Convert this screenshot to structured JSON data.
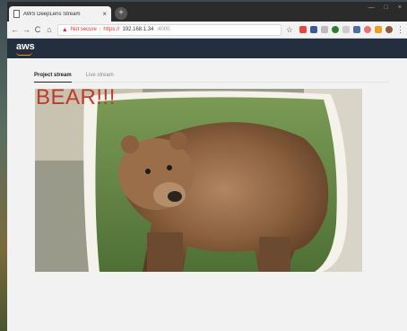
{
  "browser": {
    "tab_title": "AWS DeepLens Stream",
    "tab_close": "×",
    "new_tab": "+",
    "window_controls": [
      "—",
      "□",
      "×"
    ],
    "nav": {
      "back": "←",
      "forward": "→",
      "reload": "C",
      "home": "⌂"
    },
    "security_label": "Not secure",
    "url_scheme": "https://",
    "url_host": "192.168.1.34",
    "url_port": ":4000",
    "bookmark_icon": "star-icon"
  },
  "app": {
    "logo_text": "aws",
    "tabs": [
      {
        "label": "Project stream",
        "active": true
      },
      {
        "label": "Live stream",
        "active": false
      }
    ]
  },
  "stream": {
    "overlay_label": "BEAR!!!",
    "overlay_color": "#c0392b"
  },
  "colors": {
    "aws_nav": "#232f3e",
    "aws_accent": "#ff9900",
    "warning": "#d93025"
  }
}
